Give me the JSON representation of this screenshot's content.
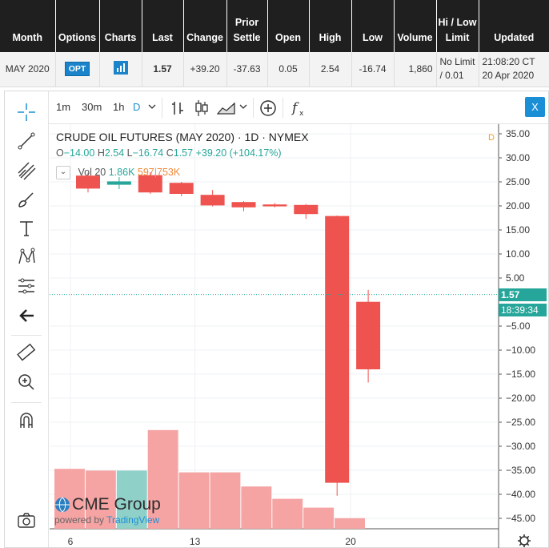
{
  "table": {
    "headers": [
      "Month",
      "Options",
      "Charts",
      "Last",
      "Change",
      "Prior Settle",
      "Open",
      "High",
      "Low",
      "Volume",
      "Hi / Low Limit",
      "Updated"
    ],
    "row": {
      "month": "MAY 2020",
      "options": "OPT",
      "charts_icon": "bar-chart-icon",
      "last": "1.57",
      "change": "+39.20",
      "prior_settle": "-37.63",
      "open": "0.05",
      "high": "2.54",
      "low": "-16.74",
      "volume": "1,860",
      "limit_line1": "No Limit",
      "limit_line2": "/ 0.01",
      "updated_line1": "21:08:20 CT",
      "updated_line2": "20 Apr 2020"
    }
  },
  "toolbar": {
    "intervals": [
      "1m",
      "30m",
      "1h",
      "D"
    ],
    "active_interval": "D",
    "icons": [
      "bar-style-icon",
      "candle-style-icon",
      "area-style-icon",
      "chevron-down-icon",
      "add-compare-icon",
      "indicators-icon"
    ],
    "close_label": "X"
  },
  "side_tools": [
    "crosshair-icon",
    "trend-line-icon",
    "pitchfork-icon",
    "brush-icon",
    "text-icon",
    "pattern-icon",
    "measure-levels-icon",
    "back-arrow-icon",
    "ruler-icon",
    "zoom-in-icon",
    "magnet-icon",
    "camera-icon"
  ],
  "legend": {
    "title": "CRUDE OIL FUTURES (MAY 2020) · 1D · NYMEX",
    "o_label": "O",
    "o_value": "−14.00",
    "h_label": "H",
    "h_value": "2.54",
    "l_label": "L",
    "l_value": "−16.74",
    "c_label": "C",
    "c_value": "1.57",
    "change": "+39.20 (+104.17%)",
    "vol_label": "Vol 20",
    "vol_value1": "1.86K",
    "vol_value2": "597",
    "vol_value3": "753K",
    "d_marker": "D"
  },
  "price_tags": {
    "last_price": "1.57",
    "countdown": "18:39:34"
  },
  "watermark": {
    "brand": "CME Group",
    "powered_by": "powered by",
    "tv": "TradingView"
  },
  "colors": {
    "up": "#26a69a",
    "down": "#ef5350",
    "vol_up": "#8fd1c9",
    "vol_down": "#f5a3a3",
    "accent": "#1b83c9"
  },
  "chart_data": {
    "type": "candlestick",
    "title": "CRUDE OIL FUTURES (MAY 2020) · 1D · NYMEX",
    "x_ticks": [
      {
        "label": "6",
        "index": 0
      },
      {
        "label": "13",
        "index": 4
      },
      {
        "label": "20",
        "index": 9
      }
    ],
    "y_ticks": [
      35,
      30,
      25,
      20,
      15,
      10,
      5,
      -5,
      -10,
      -15,
      -20,
      -25,
      -30,
      -35,
      -40,
      -45
    ],
    "ylim": [
      -48,
      37
    ],
    "candles": [
      {
        "o": 26.3,
        "h": 26.9,
        "l": 22.8,
        "c": 23.6
      },
      {
        "o": 24.4,
        "h": 26.0,
        "l": 23.5,
        "c": 25.1
      },
      {
        "o": 26.4,
        "h": 27.0,
        "l": 22.5,
        "c": 22.8
      },
      {
        "o": 24.8,
        "h": 25.0,
        "l": 22.0,
        "c": 22.5
      },
      {
        "o": 22.3,
        "h": 23.3,
        "l": 19.9,
        "c": 20.1
      },
      {
        "o": 20.8,
        "h": 21.0,
        "l": 18.9,
        "c": 19.7
      },
      {
        "o": 20.3,
        "h": 20.6,
        "l": 19.7,
        "c": 19.9
      },
      {
        "o": 20.2,
        "h": 20.4,
        "l": 17.3,
        "c": 18.3
      },
      {
        "o": 17.9,
        "h": 18.0,
        "l": -40.3,
        "c": -37.6
      },
      {
        "o": 0.05,
        "h": 2.54,
        "l": -16.74,
        "c": -14.0
      }
    ],
    "volume_note": "volume bars relative heights",
    "volume": [
      0.34,
      0.33,
      0.33,
      0.56,
      0.32,
      0.32,
      0.24,
      0.17,
      0.12,
      0.06
    ],
    "volume_up": [
      false,
      false,
      true,
      false,
      false,
      false,
      false,
      false,
      false,
      false
    ],
    "last_price": 1.57
  }
}
